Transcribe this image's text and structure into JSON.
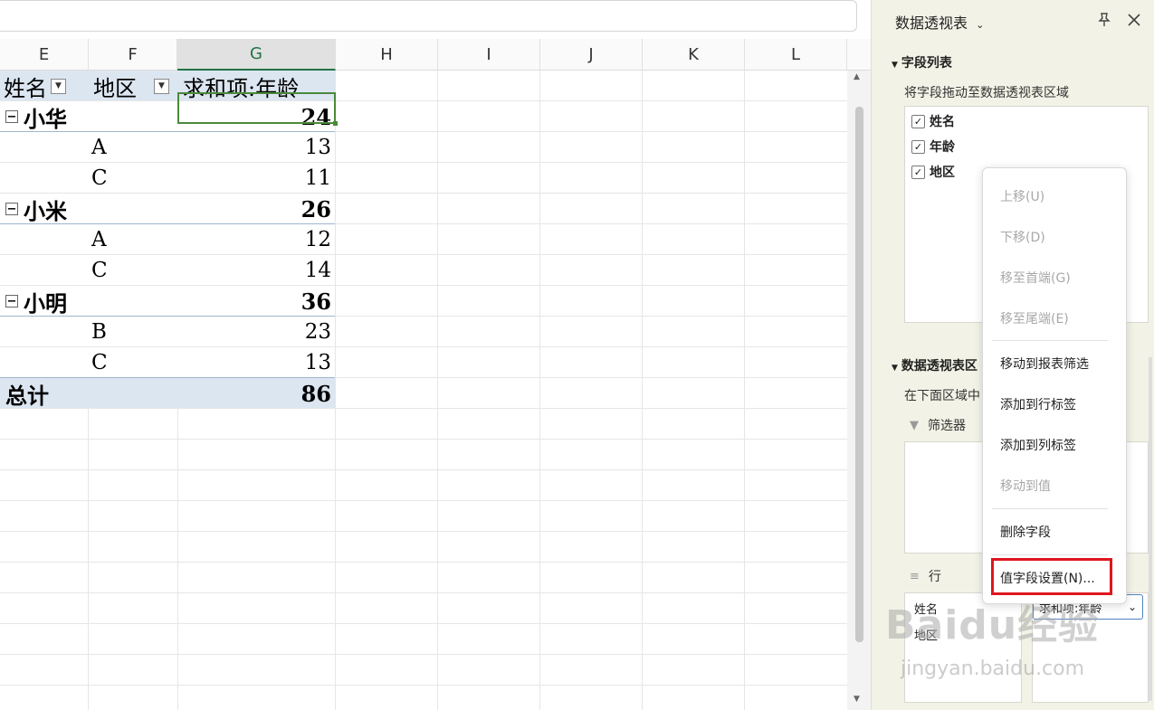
{
  "columns": [
    {
      "label": "E",
      "selected": false
    },
    {
      "label": "F",
      "selected": false
    },
    {
      "label": "G",
      "selected": true
    },
    {
      "label": "H",
      "selected": false
    },
    {
      "label": "I",
      "selected": false
    },
    {
      "label": "J",
      "selected": false
    },
    {
      "label": "K",
      "selected": false
    },
    {
      "label": "L",
      "selected": false
    }
  ],
  "pivot": {
    "header": {
      "name": "姓名",
      "region": "地区",
      "value": "求和项:年龄"
    },
    "groups": [
      {
        "name": "小华",
        "total": "24",
        "rows": [
          {
            "region": "A",
            "value": "13"
          },
          {
            "region": "C",
            "value": "11"
          }
        ]
      },
      {
        "name": "小米",
        "total": "26",
        "rows": [
          {
            "region": "A",
            "value": "12"
          },
          {
            "region": "C",
            "value": "14"
          }
        ]
      },
      {
        "name": "小明",
        "total": "36",
        "rows": [
          {
            "region": "B",
            "value": "23"
          },
          {
            "region": "C",
            "value": "13"
          }
        ]
      }
    ],
    "grand_total_label": "总计",
    "grand_total_value": "86"
  },
  "panel": {
    "title": "数据透视表",
    "field_list_title": "字段列表",
    "field_list_desc": "将字段拖动至数据透视表区域",
    "fields": [
      {
        "label": "姓名",
        "checked": true
      },
      {
        "label": "年龄",
        "checked": true
      },
      {
        "label": "地区",
        "checked": true
      }
    ],
    "areas_title": "数据透视表区",
    "areas_desc": "在下面区域中",
    "filter_label": "筛选器",
    "row_label": "行",
    "row_items": [
      "姓名",
      "地区"
    ],
    "value_item": "求和项:年龄"
  },
  "context_menu": {
    "items": [
      {
        "label": "上移(U)",
        "disabled": true
      },
      {
        "label": "下移(D)",
        "disabled": true
      },
      {
        "label": "移至首端(G)",
        "disabled": true
      },
      {
        "label": "移至尾端(E)",
        "disabled": true
      },
      {
        "label": "移动到报表筛选",
        "disabled": false
      },
      {
        "label": "添加到行标签",
        "disabled": false
      },
      {
        "label": "添加到列标签",
        "disabled": false
      },
      {
        "label": "移动到值",
        "disabled": true
      },
      {
        "label": "删除字段",
        "disabled": false
      },
      {
        "label": "值字段设置(N)...",
        "disabled": false
      }
    ]
  },
  "watermark": {
    "logo": "Baidu经验",
    "url": "jingyan.baidu.com"
  },
  "colors": {
    "accent_green": "#217346",
    "pivot_header_bg": "#dce6f1",
    "highlight_red": "#e0161e",
    "panel_bg": "#f2f2e6"
  }
}
